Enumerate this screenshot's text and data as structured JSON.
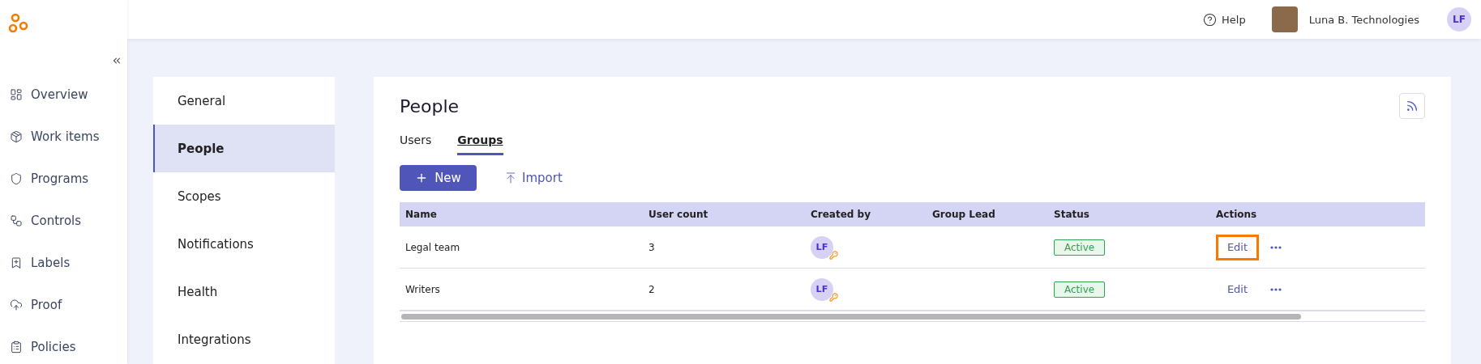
{
  "header": {
    "help": "Help",
    "org": "Luna B. Technologies",
    "user_initials": "LF"
  },
  "sidebar": {
    "items": [
      {
        "label": "Overview"
      },
      {
        "label": "Work items"
      },
      {
        "label": "Programs"
      },
      {
        "label": "Controls"
      },
      {
        "label": "Labels"
      },
      {
        "label": "Proof"
      },
      {
        "label": "Policies"
      }
    ]
  },
  "settings_menu": [
    {
      "label": "General",
      "selected": false
    },
    {
      "label": "People",
      "selected": true
    },
    {
      "label": "Scopes",
      "selected": false
    },
    {
      "label": "Notifications",
      "selected": false
    },
    {
      "label": "Health",
      "selected": false
    },
    {
      "label": "Integrations",
      "selected": false
    }
  ],
  "page": {
    "title": "People",
    "tabs": [
      {
        "label": "Users",
        "selected": false
      },
      {
        "label": "Groups",
        "selected": true
      }
    ],
    "new_button": "New",
    "import_button": "Import",
    "table": {
      "columns": [
        "Name",
        "User count",
        "Created by",
        "Group Lead",
        "Status",
        "Actions"
      ],
      "rows": [
        {
          "name": "Legal team",
          "user_count": "3",
          "created_by": "LF",
          "status": "Active",
          "edit": "Edit",
          "edit_highlighted": true
        },
        {
          "name": "Writers",
          "user_count": "2",
          "created_by": "LF",
          "status": "Active",
          "edit": "Edit",
          "edit_highlighted": false
        }
      ]
    }
  }
}
